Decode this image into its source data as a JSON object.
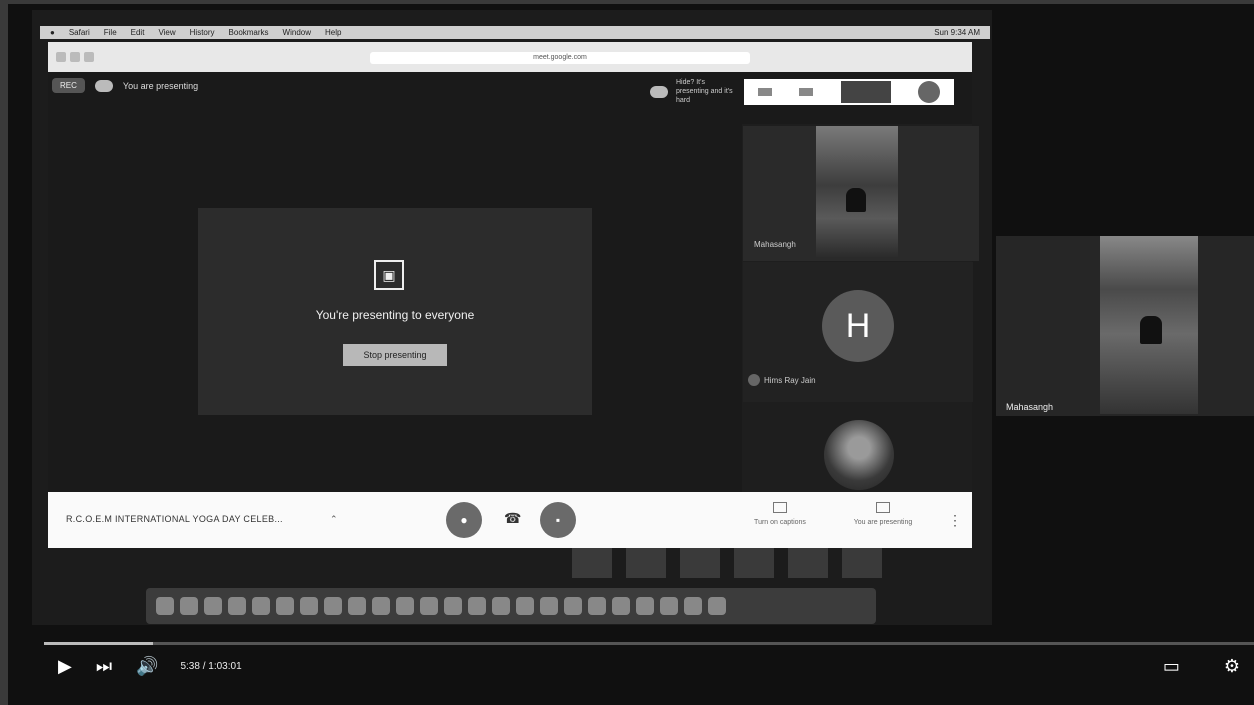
{
  "menubar": {
    "items": [
      "Safari",
      "File",
      "Edit",
      "View",
      "History",
      "Bookmarks",
      "Window",
      "Help"
    ],
    "right": "Sun 9:34 AM"
  },
  "browser": {
    "url": "meet.google.com"
  },
  "meet": {
    "rec_label": "REC",
    "you_are_presenting_top": "You are presenting",
    "notice_text": "Hide? It's presenting and it's hard",
    "panel_title": "You're presenting to everyone",
    "stop_button": "Stop presenting",
    "participants": [
      {
        "name": "Mahasangh",
        "type": "video"
      },
      {
        "name": "Hims Ray Jain",
        "initial": "H",
        "type": "initial"
      },
      {
        "name": "",
        "type": "avatar"
      }
    ],
    "floating_name": "Mahasangh",
    "meeting_title": "R.C.O.E.M INTERNATIONAL YOGA DAY CELEB...",
    "controls": {
      "captions_label": "Turn on captions",
      "presenting_label": "You are presenting"
    }
  },
  "player": {
    "time": "5:38 / 1:03:01",
    "progress": 0.09
  },
  "icons": {
    "play": "play-icon",
    "next": "next-icon",
    "volume": "volume-icon",
    "subtitles": "subtitles-icon",
    "settings": "settings-icon"
  }
}
